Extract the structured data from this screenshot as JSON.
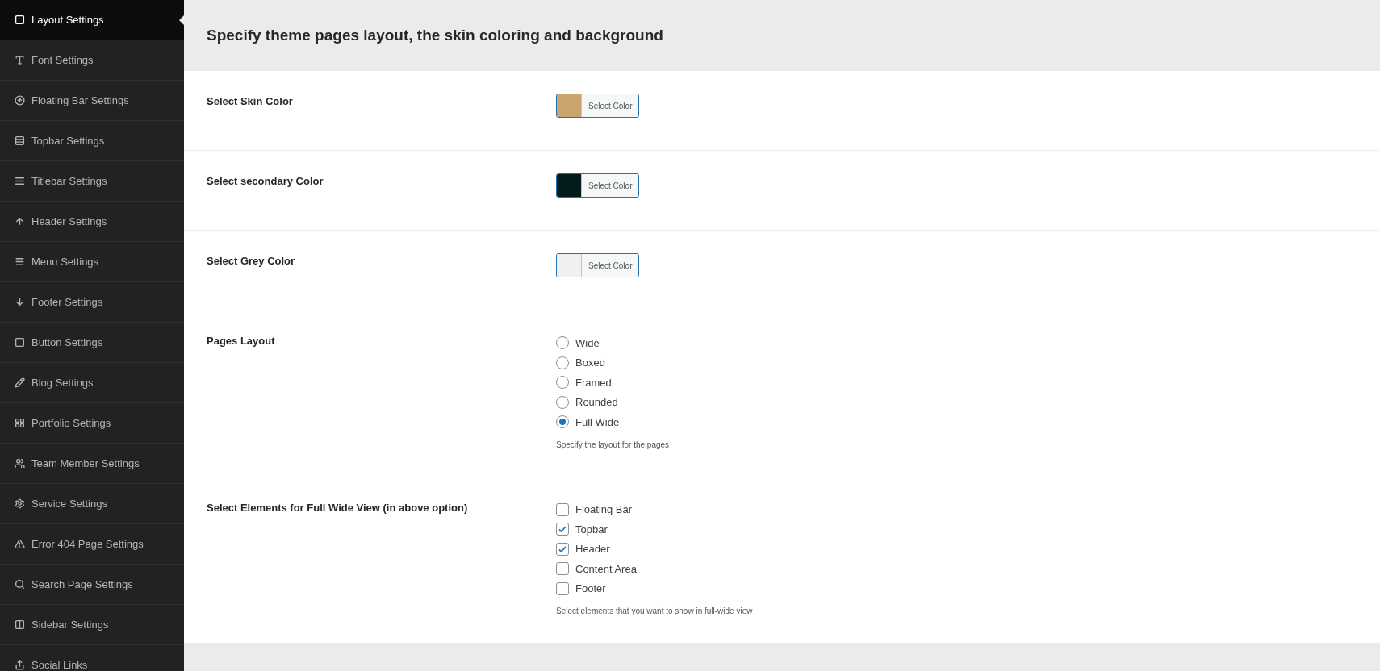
{
  "sidebar": {
    "items": [
      {
        "label": "Layout Settings",
        "selected": true
      },
      {
        "label": "Font Settings",
        "selected": false
      },
      {
        "label": "Floating Bar Settings",
        "selected": false
      },
      {
        "label": "Topbar Settings",
        "selected": false
      },
      {
        "label": "Titlebar Settings",
        "selected": false
      },
      {
        "label": "Header Settings",
        "selected": false
      },
      {
        "label": "Menu Settings",
        "selected": false
      },
      {
        "label": "Footer Settings",
        "selected": false
      },
      {
        "label": "Button Settings",
        "selected": false
      },
      {
        "label": "Blog Settings",
        "selected": false
      },
      {
        "label": "Portfolio Settings",
        "selected": false
      },
      {
        "label": "Team Member Settings",
        "selected": false
      },
      {
        "label": "Service Settings",
        "selected": false
      },
      {
        "label": "Error 404 Page Settings",
        "selected": false
      },
      {
        "label": "Search Page Settings",
        "selected": false
      },
      {
        "label": "Sidebar Settings",
        "selected": false
      },
      {
        "label": "Social Links",
        "selected": false
      }
    ]
  },
  "page": {
    "title": "Specify theme pages layout, the skin coloring and background"
  },
  "settings": [
    {
      "kind": "color",
      "label": "Select Skin Color",
      "button": "Select Color",
      "color": "#c9a46e"
    },
    {
      "kind": "color",
      "label": "Select secondary Color",
      "button": "Select Color",
      "color": "#031b1b"
    },
    {
      "kind": "color",
      "label": "Select Grey Color",
      "button": "Select Color",
      "color": "#f2f0ee"
    },
    {
      "kind": "radio",
      "label": "Pages Layout",
      "options": [
        {
          "label": "Wide",
          "selected": false
        },
        {
          "label": "Boxed",
          "selected": false
        },
        {
          "label": "Framed",
          "selected": false
        },
        {
          "label": "Rounded",
          "selected": false
        },
        {
          "label": "Full Wide",
          "selected": true
        }
      ],
      "description": "Specify the layout for the pages"
    },
    {
      "kind": "checkbox",
      "label": "Select Elements for Full Wide View (in above option)",
      "options": [
        {
          "label": "Floating Bar",
          "checked": false
        },
        {
          "label": "Topbar",
          "checked": true
        },
        {
          "label": "Header",
          "checked": true
        },
        {
          "label": "Content Area",
          "checked": false
        },
        {
          "label": "Footer",
          "checked": false
        }
      ],
      "description": "Select elements that you want to show in full-wide view"
    }
  ]
}
